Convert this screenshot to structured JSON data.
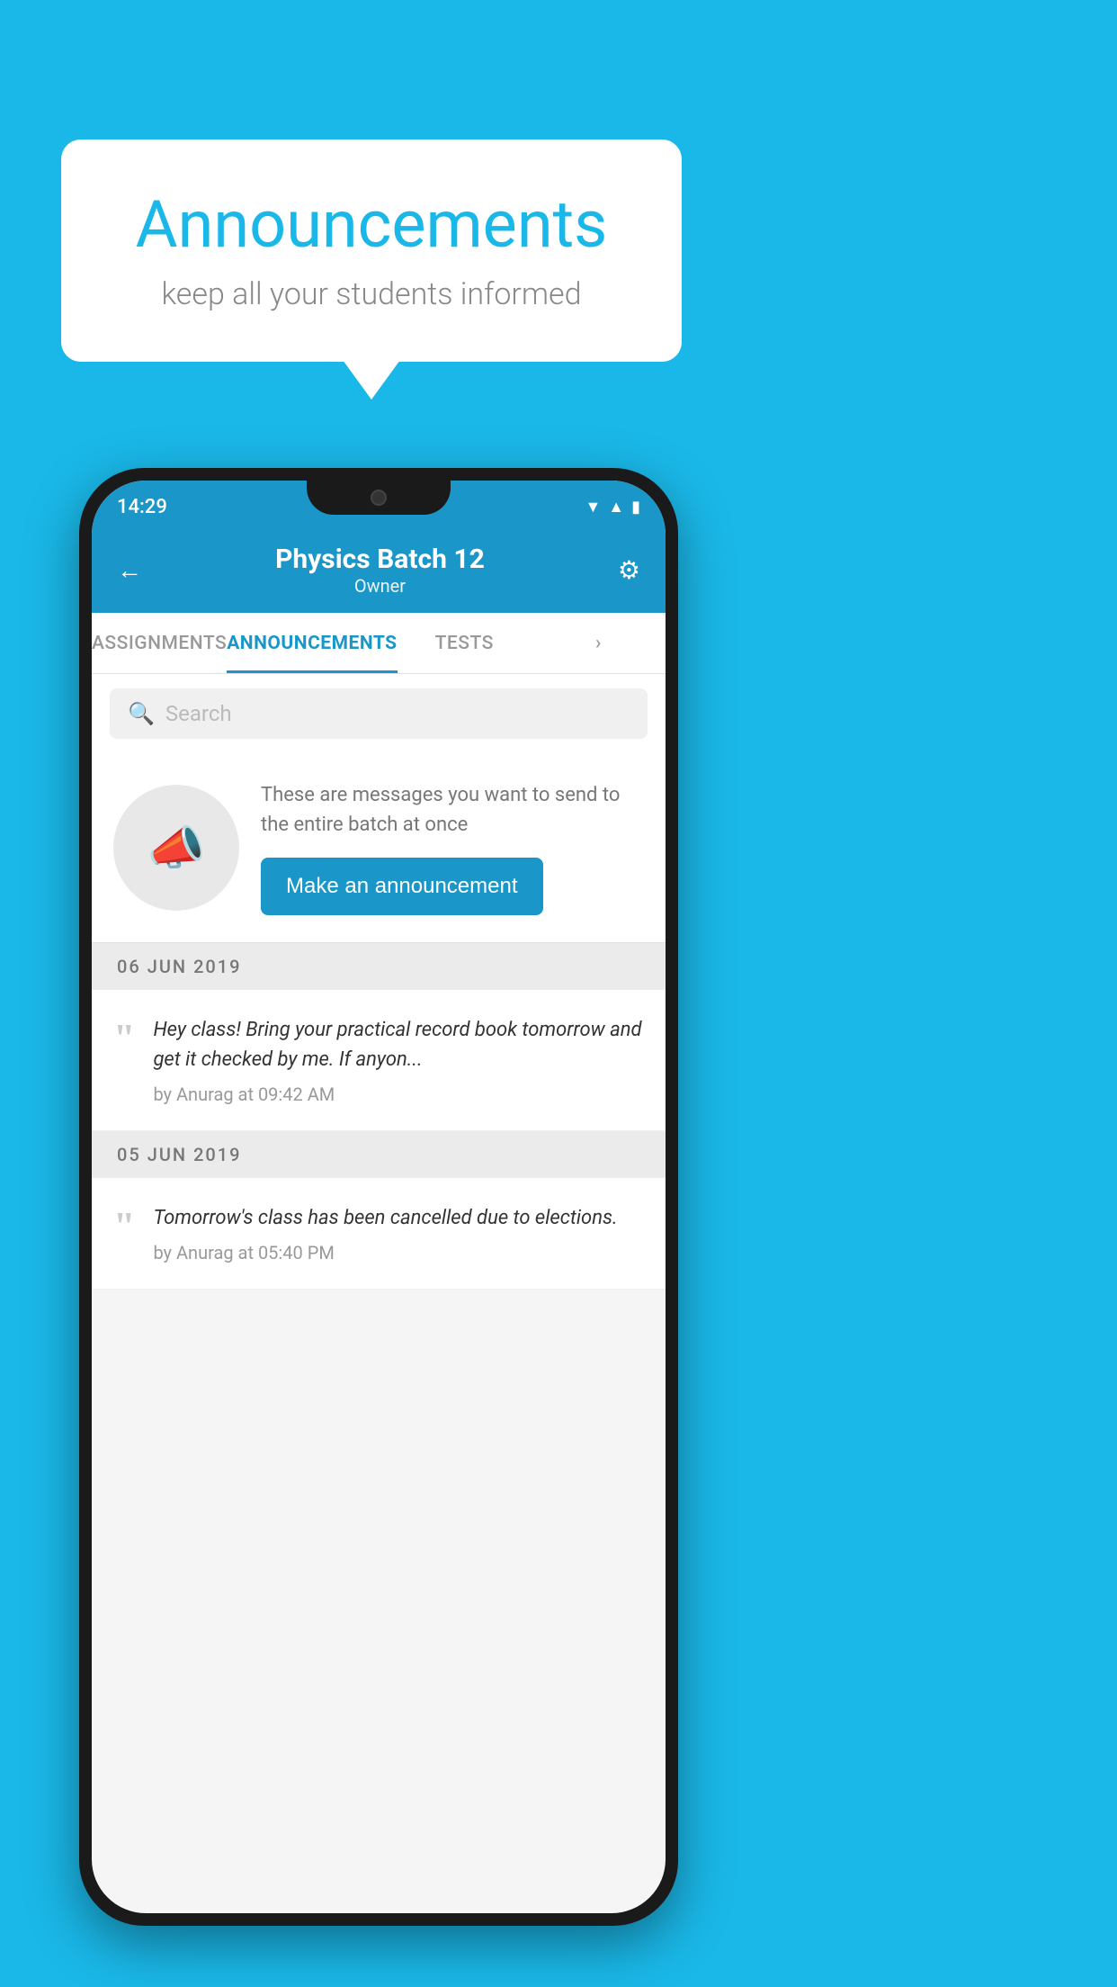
{
  "bubble": {
    "title": "Announcements",
    "subtitle": "keep all your students informed"
  },
  "status_bar": {
    "time": "14:29"
  },
  "header": {
    "title": "Physics Batch 12",
    "subtitle": "Owner",
    "back_label": "←",
    "settings_label": "⚙"
  },
  "tabs": [
    {
      "label": "ASSIGNMENTS",
      "active": false
    },
    {
      "label": "ANNOUNCEMENTS",
      "active": true
    },
    {
      "label": "TESTS",
      "active": false
    },
    {
      "label": "+",
      "active": false
    }
  ],
  "search": {
    "placeholder": "Search"
  },
  "announcement_prompt": {
    "description": "These are messages you want to send to the entire batch at once",
    "button_label": "Make an announcement"
  },
  "date_sections": [
    {
      "date": "06  JUN  2019",
      "items": [
        {
          "text": "Hey class! Bring your practical record book tomorrow and get it checked by me. If anyon...",
          "meta": "by Anurag at 09:42 AM"
        }
      ]
    },
    {
      "date": "05  JUN  2019",
      "items": [
        {
          "text": "Tomorrow's class has been cancelled due to elections.",
          "meta": "by Anurag at 05:40 PM"
        }
      ]
    }
  ],
  "colors": {
    "accent": "#1a96c8",
    "background": "#1ab8e8"
  }
}
